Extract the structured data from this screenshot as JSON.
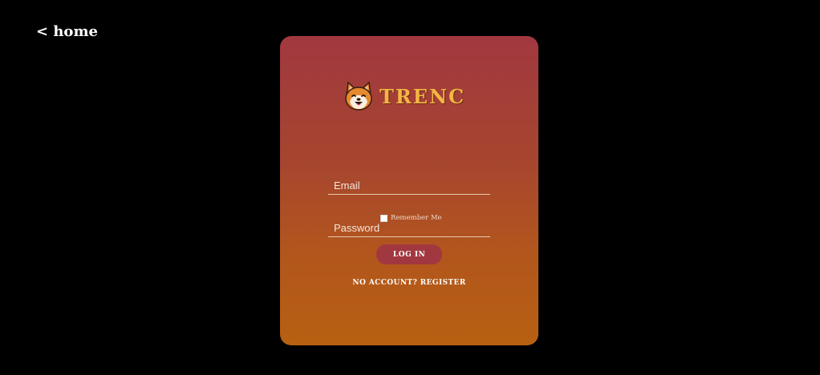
{
  "nav": {
    "home_label": "< home"
  },
  "brand": {
    "name": "TRENC",
    "logo_icon": "shiba-dog-face-icon",
    "color": "#f4b544"
  },
  "form": {
    "email_placeholder": "Email",
    "email_value": "",
    "password_placeholder": "Password",
    "password_value": "",
    "remember_label": "Remember Me",
    "remember_checked": false,
    "login_label": "LOG IN",
    "register_label": "NO ACCOUNT? REGISTER"
  },
  "colors": {
    "background": "#000000",
    "card_top": "#a13840",
    "card_bottom": "#b76012",
    "button": "#a2383f"
  }
}
